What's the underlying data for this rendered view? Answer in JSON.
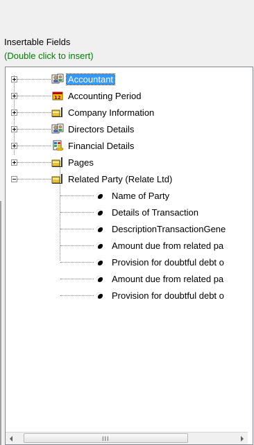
{
  "panel": {
    "title": "Insertable Fields",
    "hint": "(Double click to insert)"
  },
  "tree": {
    "nodes": [
      {
        "label": "Accountant",
        "icon": "people-icon",
        "state": "collapsed",
        "selected": true
      },
      {
        "label": "Accounting Period",
        "icon": "calendar-icon",
        "state": "collapsed",
        "selected": false
      },
      {
        "label": "Company Information",
        "icon": "folder-icon",
        "state": "collapsed",
        "selected": false
      },
      {
        "label": "Directors Details",
        "icon": "people-icon",
        "state": "collapsed",
        "selected": false
      },
      {
        "label": "Financial Details",
        "icon": "financial-icon",
        "state": "collapsed",
        "selected": false
      },
      {
        "label": "Pages",
        "icon": "folder-icon",
        "state": "collapsed",
        "selected": false
      },
      {
        "label": "Related Party (Relate Ltd)",
        "icon": "folder-icon",
        "state": "expanded",
        "selected": false,
        "children": [
          "Name of Party",
          "Details of Transaction",
          "DescriptionTransactionGene",
          "Amount due from related pa",
          "Provision for doubtful debt o",
          "Amount due from related pa",
          "Provision for doubtful debt o"
        ]
      }
    ]
  },
  "scrollbar": {
    "grip": "III"
  },
  "colors": {
    "hint": "#008000",
    "selection": "#3399ff",
    "tree_border": "#828790"
  }
}
